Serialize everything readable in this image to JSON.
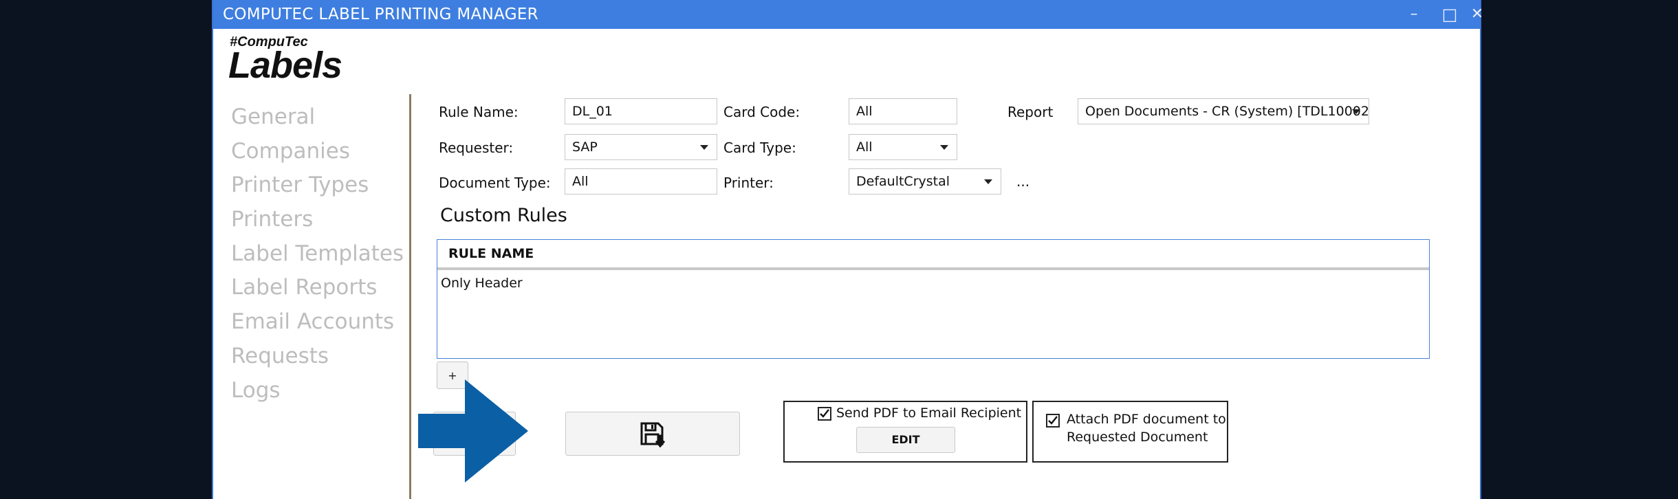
{
  "window": {
    "title": "COMPUTEC LABEL PRINTING MANAGER",
    "minimize": "–",
    "maximize": "□",
    "close": "✕"
  },
  "logo": {
    "small": "#CompuTec",
    "big": "Labels"
  },
  "sidebar": {
    "items": [
      {
        "label": "General"
      },
      {
        "label": "Companies"
      },
      {
        "label": "Printer Types"
      },
      {
        "label": "Printers"
      },
      {
        "label": "Label Templates"
      },
      {
        "label": "Label Reports"
      },
      {
        "label": "Email Accounts"
      },
      {
        "label": "Requests"
      },
      {
        "label": "Logs"
      }
    ]
  },
  "form": {
    "rule_name_label": "Rule Name:",
    "rule_name_value": "DL_01",
    "card_code_label": "Card Code:",
    "card_code_value": "All",
    "report_label": "Report",
    "report_value": "Open Documents - CR (System)  [TDL10002]",
    "requester_label": "Requester:",
    "requester_value": "SAP",
    "card_type_label": "Card Type:",
    "card_type_value": "All",
    "document_type_label": "Document Type:",
    "document_type_value": "All",
    "printer_label": "Printer:",
    "printer_value": "DefaultCrystal",
    "printer_more": "..."
  },
  "custom_rules": {
    "title": "Custom Rules",
    "column_header": "RULE NAME",
    "rows": [
      "Only Header"
    ],
    "add_button": "+"
  },
  "options": {
    "send_pdf_label": "Send PDF to Email Recipient",
    "send_pdf_checked": true,
    "edit_button": "EDIT",
    "attach_pdf_label_line1": "Attach PDF document to",
    "attach_pdf_label_line2": "Requested Document",
    "attach_pdf_checked": true
  },
  "colors": {
    "titlebar": "#3e7ee0",
    "arrow": "#0b5fa5",
    "nav_text": "#bdbdbd"
  },
  "icons": {
    "save": "save-icon",
    "pointer": "arrow-pointer-icon"
  }
}
